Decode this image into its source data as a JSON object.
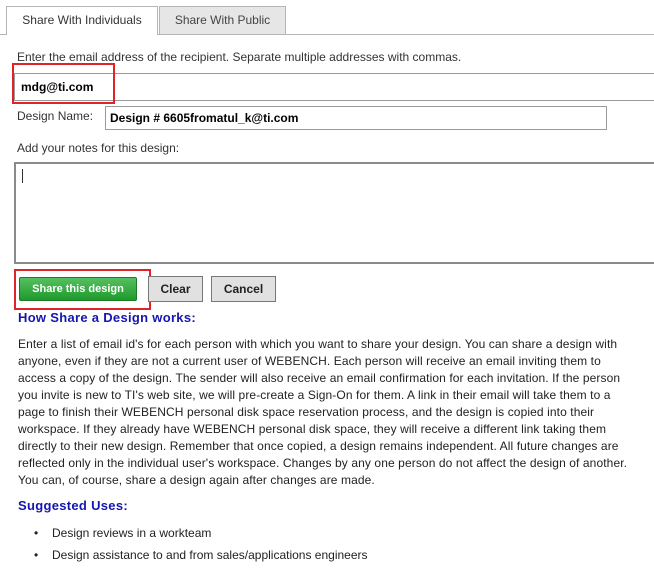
{
  "tabs": [
    {
      "label": "Share With Individuals",
      "active": true
    },
    {
      "label": "Share With Public",
      "active": false
    }
  ],
  "form": {
    "instruction": "Enter the email address of the recipient. Separate multiple addresses with commas.",
    "email_value": "mdg@ti.com",
    "design_name_label": "Design Name:",
    "design_name_value": "Design # 6605fromatul_k@ti.com",
    "notes_label": "Add your notes for this design:",
    "notes_value": ""
  },
  "buttons": {
    "share": "Share this design",
    "clear": "Clear",
    "cancel": "Cancel"
  },
  "how": {
    "title": "How Share a Design works:",
    "lines": [
      "Enter a list of email id's for each person with which you want to share your design. You can share a design with",
      "anyone, even if they are not a current user of WEBENCH. Each person will receive an email inviting them to",
      "access a copy of the design. The sender will also receive an email confirmation for each invitation. If the person",
      "you invite is new to TI's web site, we will pre-create a Sign-On for them. A link in their email will take them to a",
      "page to finish their WEBENCH personal disk space reservation process, and the design is copied into their",
      "workspace. If they already have WEBENCH personal disk space, they will receive a different link taking them",
      "directly to their new design. Remember that once copied, a design remains independent. All future changes are",
      "reflected only in the individual user's workspace. Changes by any one person do not affect the design of another.",
      "You can, of course, share a design again after changes are made."
    ]
  },
  "uses": {
    "title": "Suggested Uses:",
    "items": [
      "Design reviews in a workteam",
      "Design assistance to and from sales/applications engineers"
    ]
  },
  "colors": {
    "heading": "#1515b0",
    "highlight": "#e0232b",
    "share_button": "#1e9a2c"
  }
}
